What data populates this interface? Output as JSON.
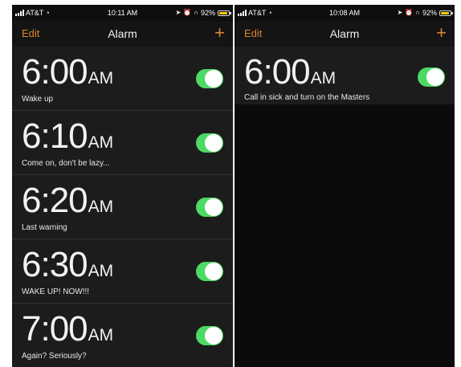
{
  "left": {
    "status": {
      "carrier": "AT&T",
      "time": "10:11 AM",
      "battery": "92%"
    },
    "nav": {
      "edit": "Edit",
      "title": "Alarm",
      "add": "+"
    },
    "alarms": [
      {
        "time": "6:00",
        "ampm": "AM",
        "label": "Wake up",
        "enabled": true
      },
      {
        "time": "6:10",
        "ampm": "AM",
        "label": "Come on, don't be lazy...",
        "enabled": true
      },
      {
        "time": "6:20",
        "ampm": "AM",
        "label": "Last warning",
        "enabled": true
      },
      {
        "time": "6:30",
        "ampm": "AM",
        "label": "WAKE UP! NOW!!!",
        "enabled": true
      },
      {
        "time": "7:00",
        "ampm": "AM",
        "label": "Again? Seriously?",
        "enabled": true
      }
    ]
  },
  "right": {
    "status": {
      "carrier": "AT&T",
      "time": "10:08 AM",
      "battery": "92%"
    },
    "nav": {
      "edit": "Edit",
      "title": "Alarm",
      "add": "+"
    },
    "alarms": [
      {
        "time": "6:00",
        "ampm": "AM",
        "label": "Call in sick and turn on the Masters",
        "enabled": true
      }
    ]
  },
  "colors": {
    "accent": "#d9862a",
    "toggle_on": "#4cd964",
    "battery": "#ffcc00",
    "row_bg": "#1c1c1c"
  }
}
